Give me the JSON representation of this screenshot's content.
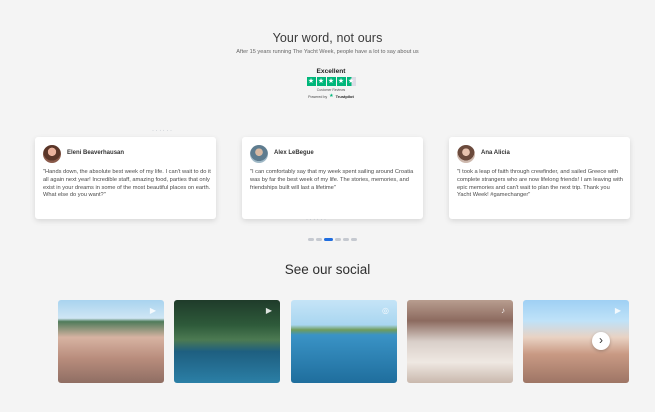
{
  "testimonials": {
    "heading": "Your word, not ours",
    "subheading": "After 15 years running The Yacht Week, people have a lot to say about us",
    "trustpilot": {
      "rating_text": "Excellent",
      "reviews_text": "Customer Reviews",
      "powered_by": "Powered by",
      "brand": "Trustpilot",
      "stars": 4.5
    },
    "cards": [
      {
        "name": "Eleni Beaverhausan",
        "quote": "\"Hands down, the absolute best week of my life. I can't wait to do it all again next year! Incredible staff, amazing food, parties that only exist in your dreams in some of the most beautiful places on earth. What else do you want?\""
      },
      {
        "name": "Alex LeBegue",
        "quote": "\"I can comfortably say that my week spent sailing around Croatia was by far the best week of my life. The stories, memories, and friendships built will last a lifetime\""
      },
      {
        "name": "Ana Alicia",
        "quote": "\"I took a leap of faith through crewfinder, and sailed Greece with complete strangers who are now lifelong friends! I am leaving with epic memories and can't wait to plan the next trip. Thank you Yacht Week! #gamechanger\""
      }
    ],
    "pager": {
      "count": 6,
      "active_index": 2
    }
  },
  "social": {
    "heading": "See our social"
  },
  "colors": {
    "trustpilot_green": "#00b67a",
    "pager_active": "#1f6ddf",
    "background": "#f4f4f4"
  }
}
